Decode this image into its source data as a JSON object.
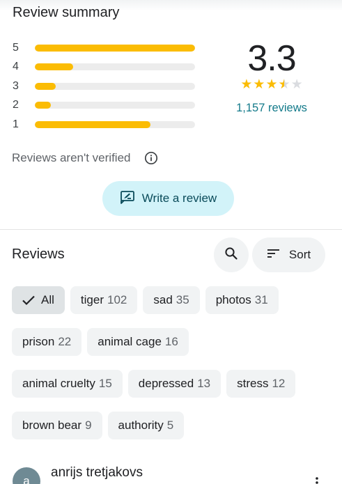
{
  "summary": {
    "title": "Review summary",
    "distribution": [
      {
        "stars": "5",
        "fraction": 1.0
      },
      {
        "stars": "4",
        "fraction": 0.24
      },
      {
        "stars": "3",
        "fraction": 0.13
      },
      {
        "stars": "2",
        "fraction": 0.1
      },
      {
        "stars": "1",
        "fraction": 0.72
      }
    ],
    "rating": "3.3",
    "rating_value": 3.3,
    "review_count": "1,157 reviews",
    "verified_note": "Reviews aren't verified",
    "write_review_label": "Write a review"
  },
  "reviews": {
    "title": "Reviews",
    "sort_label": "Sort",
    "chips": [
      [
        {
          "name": "All",
          "count": "",
          "selected": true
        },
        {
          "name": "tiger",
          "count": "102"
        },
        {
          "name": "sad",
          "count": "35"
        },
        {
          "name": "photos",
          "count": "31"
        }
      ],
      [
        {
          "name": "prison",
          "count": "22"
        },
        {
          "name": "animal cage",
          "count": "16"
        }
      ],
      [
        {
          "name": "animal cruelty",
          "count": "15"
        },
        {
          "name": "depressed",
          "count": "13"
        },
        {
          "name": "stress",
          "count": "12"
        }
      ],
      [
        {
          "name": "brown bear",
          "count": "9"
        },
        {
          "name": "authority",
          "count": "5"
        }
      ]
    ],
    "first_review": {
      "avatar_letter": "a",
      "author": "anrijs tretjakovs"
    }
  },
  "colors": {
    "star": "#fbbc04",
    "link": "#137a8a",
    "write_button_bg": "#d2f3f9"
  },
  "icons": [
    "info-icon",
    "rate-review-icon",
    "search-icon",
    "sort-icon",
    "check-icon",
    "more-vert-icon",
    "star-icon"
  ]
}
